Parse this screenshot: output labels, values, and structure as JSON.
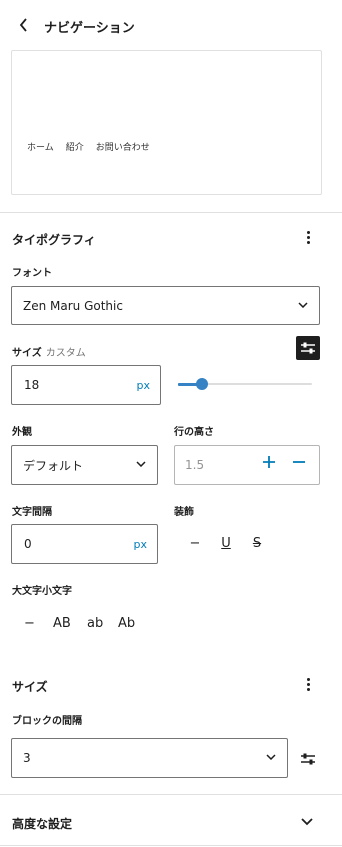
{
  "header": {
    "title": "ナビゲーション"
  },
  "preview": {
    "nav_items": [
      "ホーム",
      "紹介",
      "お問い合わせ"
    ]
  },
  "typography": {
    "title": "タイポグラフィ",
    "font_label": "フォント",
    "font_value": "Zen Maru Gothic",
    "size_label": "サイズ",
    "size_sublabel": "カスタム",
    "size_value": "18",
    "size_unit": "px",
    "size_slider_fraction": 0.18,
    "appearance_label": "外観",
    "appearance_value": "デフォルト",
    "line_height_label": "行の高さ",
    "line_height_placeholder": "1.5",
    "letter_spacing_label": "文字間隔",
    "letter_spacing_value": "0",
    "letter_spacing_unit": "px",
    "decoration_label": "装飾",
    "decoration_options": [
      "−",
      "U",
      "S"
    ],
    "case_label": "大文字小文字",
    "case_options": [
      "−",
      "AB",
      "ab",
      "Ab"
    ]
  },
  "size_section": {
    "title": "サイズ",
    "block_gap_label": "ブロックの間隔",
    "block_gap_value": "3"
  },
  "advanced": {
    "title": "高度な設定"
  },
  "colors": {
    "accent": "#007cba",
    "slider": "#3582c4",
    "dark": "#1e1e1e",
    "border": "#757575"
  }
}
